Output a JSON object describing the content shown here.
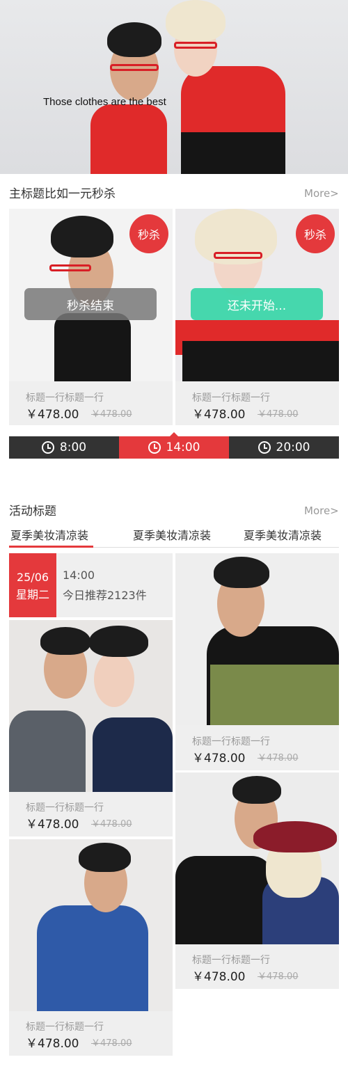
{
  "hero": {
    "caption": "Those clothes are the best"
  },
  "flash_section": {
    "title": "主标题比如一元秒杀",
    "more": "More>",
    "cards": [
      {
        "badge": "秒杀",
        "status": "秒杀结束",
        "status_color": "#8a8a8a",
        "title": "标题一行标题一行",
        "price": "￥478.00",
        "old_price": "￥478.00"
      },
      {
        "badge": "秒杀",
        "status": "还未开始...",
        "status_color": "#3dd6aa",
        "title": "标题一行标题一行",
        "price": "￥478.00",
        "old_price": "￥478.00"
      }
    ],
    "time_slots": [
      {
        "label": "8:00",
        "active": false
      },
      {
        "label": "14:00",
        "active": true
      },
      {
        "label": "20:00",
        "active": false
      }
    ]
  },
  "activity_section": {
    "title": "活动标题",
    "more": "More>",
    "tabs": [
      "夏季美妆清凉装",
      "夏季美妆清凉装",
      "夏季美妆清凉装"
    ],
    "date": {
      "day": "25/06",
      "weekday": "星期二",
      "time": "14:00",
      "recommend": "今日推荐2123件"
    },
    "products": [
      {
        "title": "标题一行标题一行",
        "price": "￥478.00",
        "old_price": "￥478.00"
      },
      {
        "title": "标题一行标题一行",
        "price": "￥478.00",
        "old_price": "￥478.00"
      },
      {
        "title": "标题一行标题一行",
        "price": "￥478.00",
        "old_price": "￥478.00"
      },
      {
        "title": "标题一行标题一行",
        "price": "￥478.00",
        "old_price": "￥478.00"
      }
    ]
  },
  "colors": {
    "accent": "#e4393c",
    "dark": "#333333",
    "teal": "#3dd6aa"
  }
}
